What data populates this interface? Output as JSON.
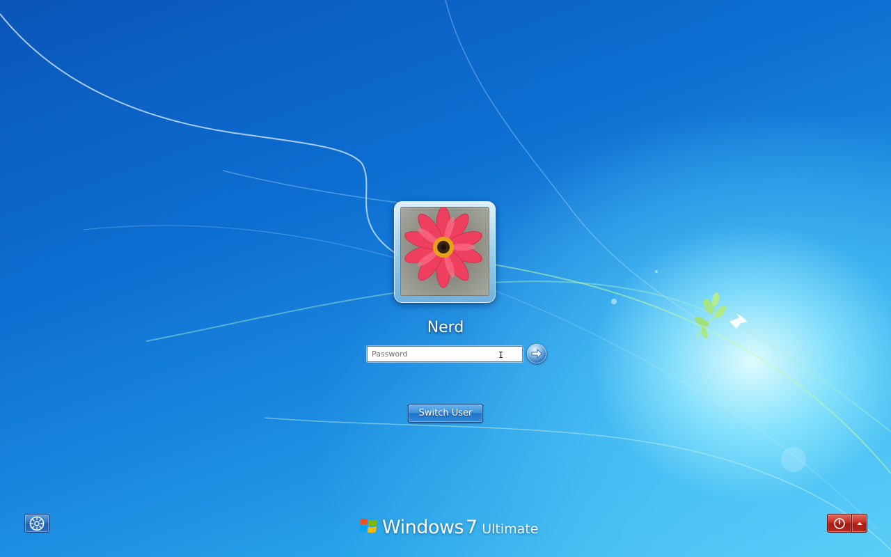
{
  "user": {
    "name": "Nerd",
    "avatar_icon": "flower-avatar-icon"
  },
  "password": {
    "placeholder": "Password",
    "value": ""
  },
  "buttons": {
    "switch_user_label": "Switch User",
    "submit_icon": "arrow-right-icon",
    "ease_of_access_icon": "ease-of-access-icon",
    "power_icon": "power-icon",
    "power_options_icon": "chevron-up-icon"
  },
  "branding": {
    "name": "Windows",
    "version": "7",
    "edition": "Ultimate",
    "logo_icon": "windows-flag-icon"
  },
  "colors": {
    "background_primary": "#0d6ed1",
    "background_glow": "#bff2ff",
    "power_button": "#c22b1f",
    "switch_user_button": "#3a8fdc"
  }
}
